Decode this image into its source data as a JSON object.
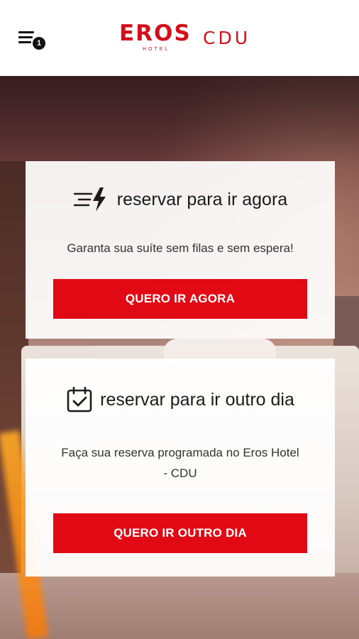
{
  "header": {
    "menu_icon": "menu-icon",
    "badge_count": "1",
    "logo_eros": "EROS",
    "logo_hotel": "HOTEL",
    "logo_unit": "CDU",
    "brand_color": "#d20f1a"
  },
  "cards": [
    {
      "icon": "fast-lightning-icon",
      "title": "reservar para ir agora",
      "description": "Garanta sua suíte sem filas e sem espera!",
      "button_label": "QUERO IR AGORA"
    },
    {
      "icon": "calendar-check-icon",
      "title": "reservar para ir outro dia",
      "description": "Faça sua reserva programada no Eros Hotel - CDU",
      "button_label": "QUERO IR OUTRO DIA"
    }
  ],
  "colors": {
    "button": "#e10a14",
    "card_bg": "#ffffff"
  }
}
